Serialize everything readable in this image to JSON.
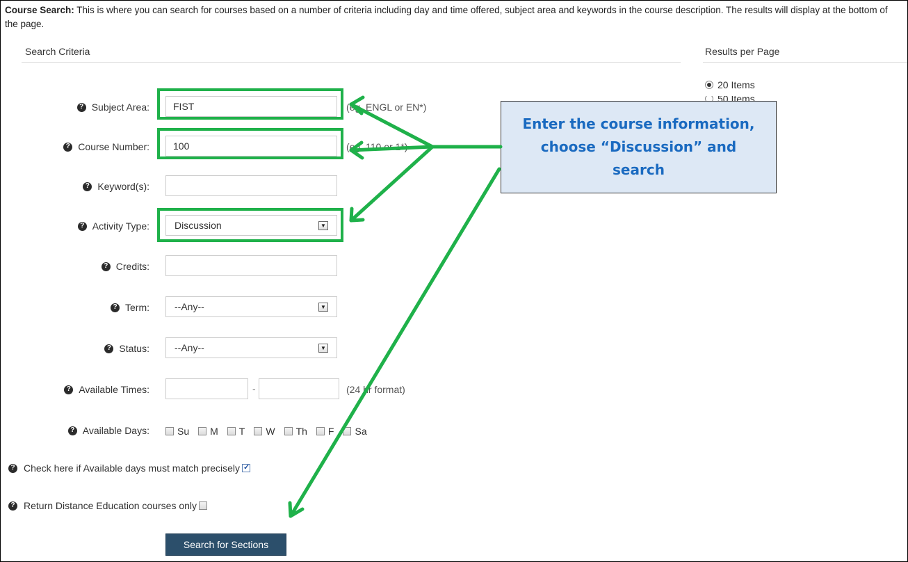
{
  "intro": {
    "title": "Course Search:",
    "text": " This is where you can search for courses based on a number of criteria including day and time offered, subject area and keywords in the course description. The results will display at the bottom of the page."
  },
  "search_criteria": {
    "heading": "Search Criteria"
  },
  "results_per_page": {
    "heading": "Results per Page",
    "options": [
      "20 Items",
      "50 Items"
    ],
    "selected": "20 Items"
  },
  "fields": {
    "subject_area": {
      "label": "Subject Area:",
      "value": "FIST",
      "hint": "(eg. ENGL or EN*)"
    },
    "course_number": {
      "label": "Course Number:",
      "value": "100",
      "hint": "(eg. 110 or 1*)"
    },
    "keywords": {
      "label": "Keyword(s):",
      "value": ""
    },
    "activity_type": {
      "label": "Activity Type:",
      "value": "Discussion"
    },
    "credits": {
      "label": "Credits:",
      "value": ""
    },
    "term": {
      "label": "Term:",
      "value": "--Any--"
    },
    "status": {
      "label": "Status:",
      "value": "--Any--"
    },
    "available_times": {
      "label": "Available Times:",
      "start": "",
      "end": "",
      "separator": "-",
      "hint": "(24 hr format)"
    },
    "available_days": {
      "label": "Available Days:",
      "days": [
        "Su",
        "M",
        "T",
        "W",
        "Th",
        "F",
        "Sa"
      ]
    },
    "match_precisely": {
      "label": "Check here if Available days must match precisely",
      "checked": true
    },
    "distance_only": {
      "label": "Return Distance Education courses only",
      "checked": false
    }
  },
  "search_button": "Search for Sections",
  "callout": {
    "text": "Enter the course information, choose “Discussion” and search"
  },
  "colors": {
    "highlight": "#1fb14a",
    "button": "#2c4f6b",
    "callout_bg": "#dde8f5",
    "callout_text": "#1a6ac0"
  },
  "icons": {
    "help": "question-circle-icon",
    "dropdown": "chevron-down-icon"
  }
}
